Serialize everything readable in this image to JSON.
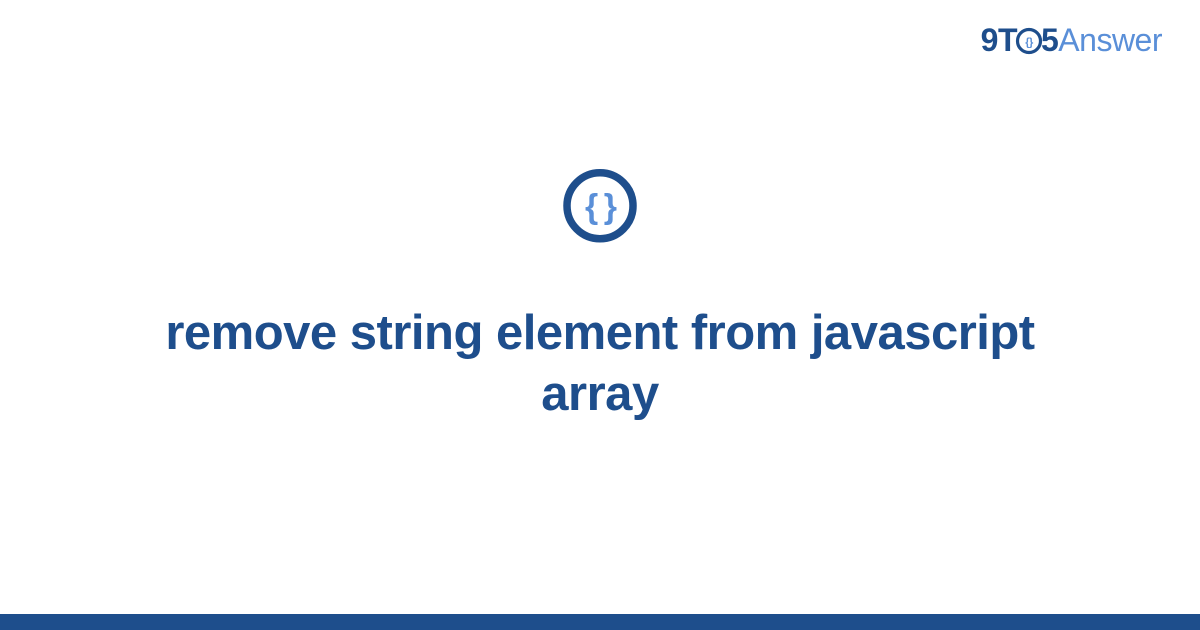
{
  "logo": {
    "part1": "9",
    "part2": "T",
    "part3": "5",
    "part4": "Answer"
  },
  "title": "remove string element from javascript array",
  "icon": {
    "name": "braces-icon",
    "glyph": "{ }"
  },
  "colors": {
    "primary": "#1e4e8c",
    "secondary": "#5a8fd8"
  }
}
